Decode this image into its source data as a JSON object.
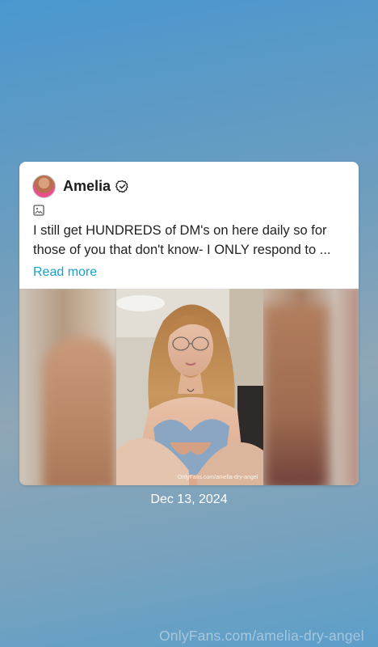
{
  "post": {
    "author_name": "Amelia",
    "text": "I still get HUNDREDS of DM's on here daily so for those of you that don't know- I ONLY respond to ...",
    "read_more_label": "Read more",
    "photo_watermark": "OnlyFans.com/amelia-dry-angel",
    "date": "Dec 13, 2024"
  },
  "page_watermark": "OnlyFans.com/amelia-dry-angel",
  "icons": {
    "verified": "verified-badge-icon",
    "media_type": "image-icon"
  },
  "colors": {
    "link": "#1aa1c9",
    "card_background": "#ffffff"
  }
}
